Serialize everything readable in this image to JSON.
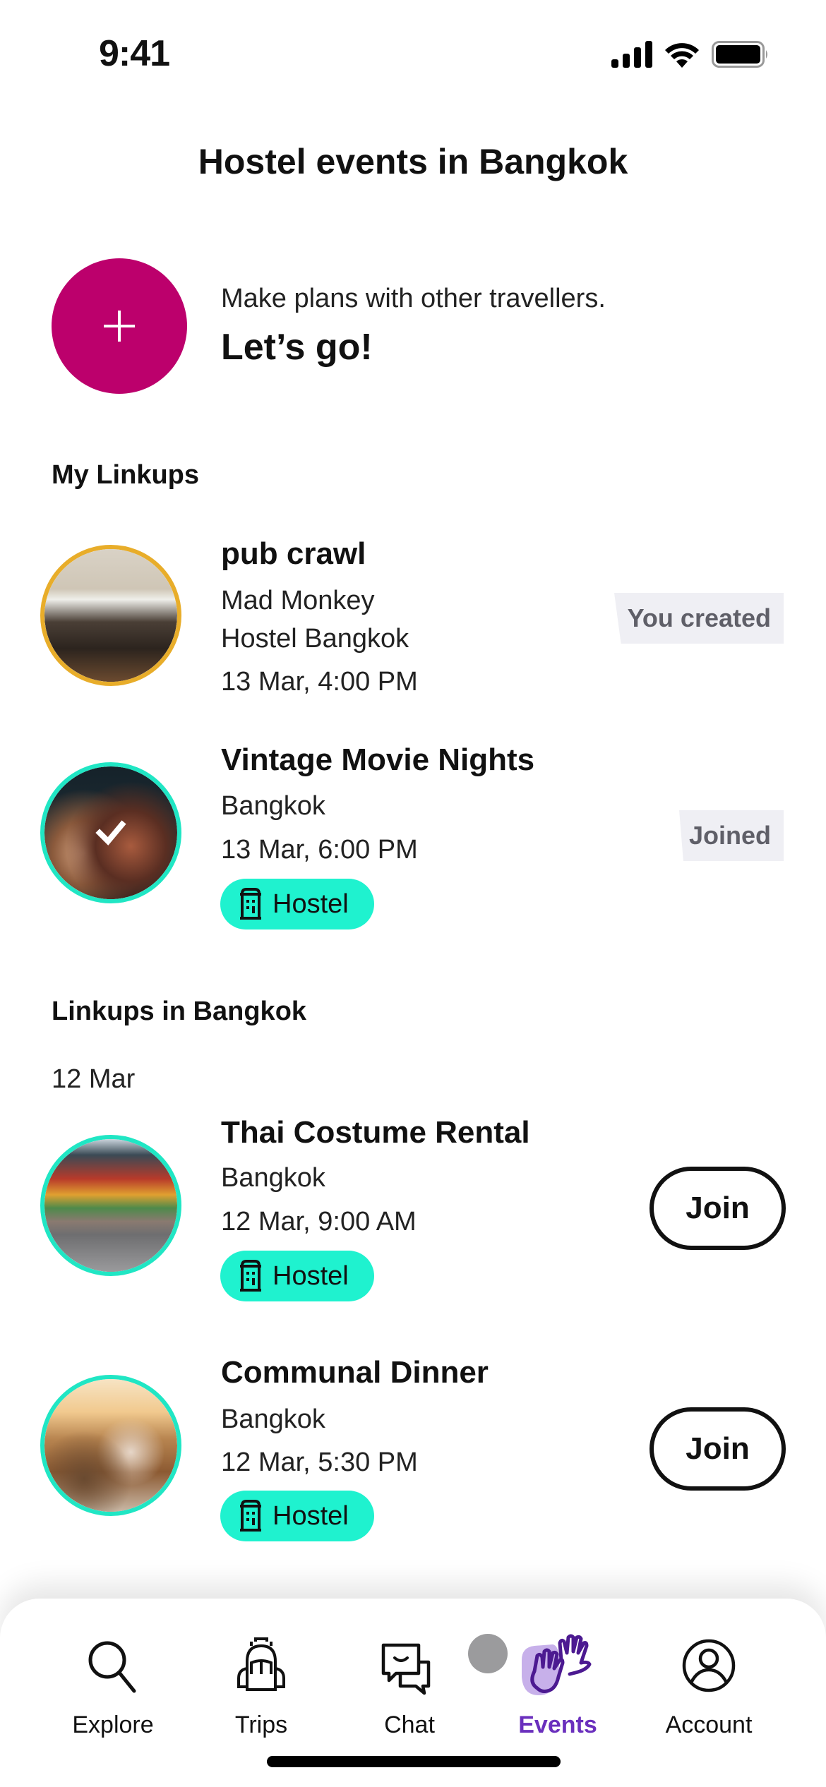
{
  "status_bar": {
    "time": "9:41",
    "icons": [
      "cellular-signal-icon",
      "wifi-icon",
      "battery-icon"
    ]
  },
  "header": {
    "title": "Hostel events in Bangkok"
  },
  "create": {
    "icon": "plus-icon",
    "subtitle": "Make plans with other travellers.",
    "cta": "Let’s go!",
    "color": "#bc006c"
  },
  "my_linkups": {
    "heading": "My Linkups",
    "items": [
      {
        "title": "pub crawl",
        "location_line1": "Mad Monkey",
        "location_line2": "Hostel Bangkok",
        "datetime": "13 Mar, 4:00 PM",
        "status": "You created",
        "ring_color": "#e8ad2a"
      },
      {
        "title": "Vintage Movie Nights",
        "location_line1": "Bangkok",
        "datetime": "13 Mar, 6:00 PM",
        "tag": "Hostel",
        "status": "Joined",
        "ring_color": "#20e6c4",
        "checked": true
      }
    ]
  },
  "city_linkups": {
    "heading": "Linkups in Bangkok",
    "groups": [
      {
        "date": "12 Mar",
        "items": [
          {
            "title": "Thai Costume Rental",
            "location_line1": "Bangkok",
            "datetime": "12 Mar, 9:00 AM",
            "tag": "Hostel",
            "action": "Join"
          },
          {
            "title": "Communal Dinner",
            "location_line1": "Bangkok",
            "datetime": "12 Mar, 5:30 PM",
            "tag": "Hostel",
            "action": "Join"
          }
        ]
      }
    ]
  },
  "tabbar": {
    "active": "Events",
    "accent": "#6a2fbd",
    "items": [
      {
        "label": "Explore",
        "icon": "search-icon"
      },
      {
        "label": "Trips",
        "icon": "backpack-icon"
      },
      {
        "label": "Chat",
        "icon": "chat-bubbles-icon"
      },
      {
        "label": "Events",
        "icon": "high-five-hands-icon"
      },
      {
        "label": "Account",
        "icon": "user-circle-icon"
      }
    ]
  }
}
